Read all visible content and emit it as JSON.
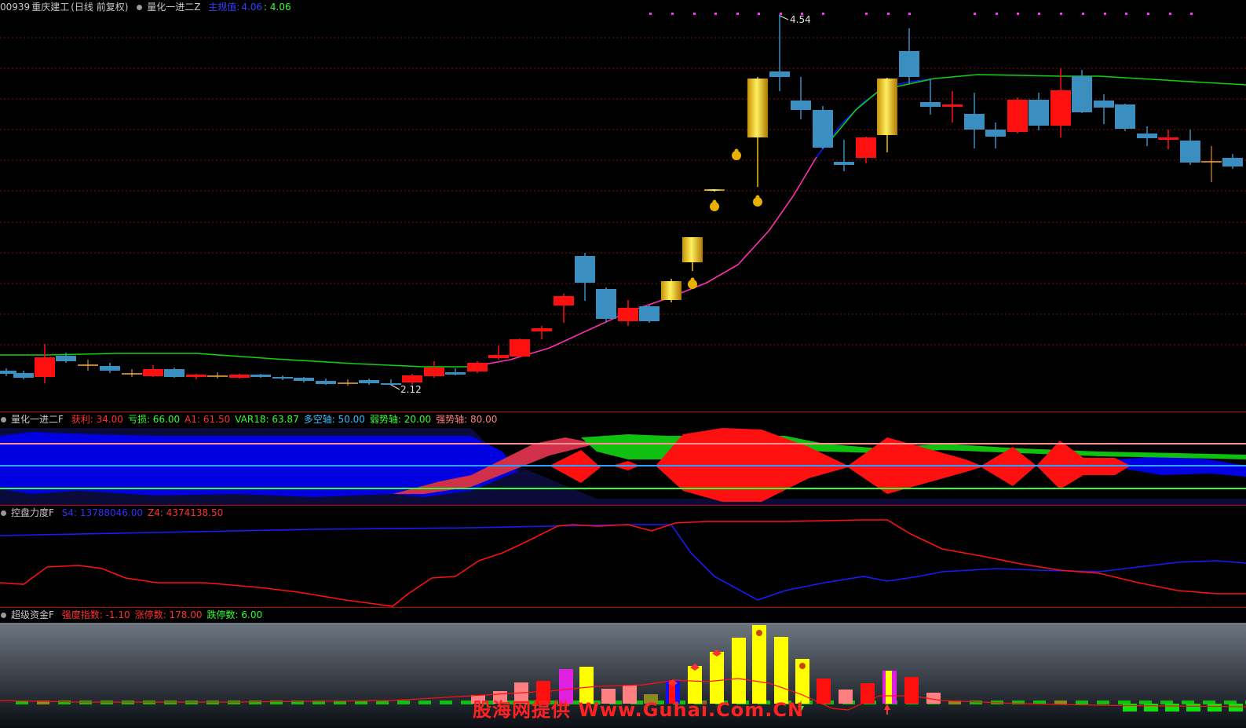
{
  "main": {
    "code": "00939",
    "name": "重庆建工",
    "mode": "(日线 前复权)",
    "indicator": "量化一进二Z",
    "param_label": "主规值:",
    "param_value": "4.06",
    "param_value2": ": 4.06",
    "high_label": "4.54",
    "low_label": "2.12"
  },
  "sub1": {
    "name": "量化一进二F",
    "items": [
      {
        "label": "获利: 34.00",
        "color": "#ff3030"
      },
      {
        "label": "亏损: 66.00",
        "color": "#30ff30"
      },
      {
        "label": "A1: 61.50",
        "color": "#ff3030"
      },
      {
        "label": "VAR18: 63.87",
        "color": "#30ff30"
      },
      {
        "label": "多空轴: 50.00",
        "color": "#30c0ff"
      },
      {
        "label": "弱势轴: 20.00",
        "color": "#30ff30"
      },
      {
        "label": "强势轴: 80.00",
        "color": "#ff8080"
      }
    ]
  },
  "sub2": {
    "name": "控盘力度F",
    "items": [
      {
        "label": "S4: 13788046.00",
        "color": "#3030ff"
      },
      {
        "label": "Z4: 4374138.50",
        "color": "#ff3030"
      }
    ]
  },
  "sub3": {
    "name": "超级资金F",
    "items": [
      {
        "label": "强度指数: -1.10",
        "color": "#ff3030"
      },
      {
        "label": "涨停数: 178.00",
        "color": "#ff3030"
      },
      {
        "label": "跌停数: 6.00",
        "color": "#30ff30"
      }
    ]
  },
  "watermark": "股海网提供 Www.Guhai.Com.CN",
  "colors": {
    "up": "#ff1010",
    "down": "#3a8fc0",
    "limit": "#f0c000",
    "ma_green": "#10d010",
    "ma_blue": "#1010ff",
    "ma_pink": "#ff30b0"
  }
}
